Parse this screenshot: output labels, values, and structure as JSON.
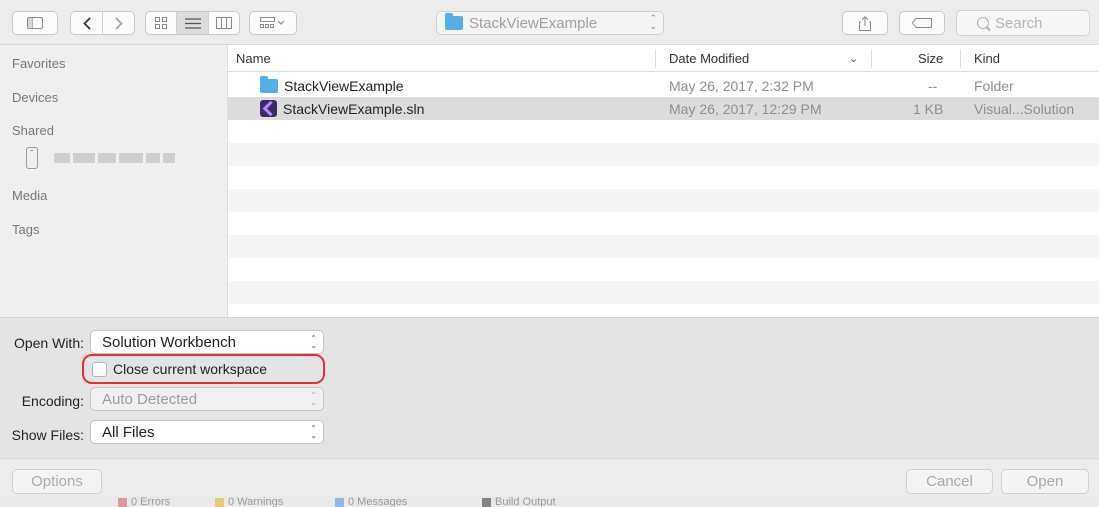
{
  "toolbar": {
    "sidebar_toggle_icon": "sidebar-icon",
    "back_icon": "chevron-left-icon",
    "forward_icon": "chevron-right-icon",
    "view_modes": [
      "icon-view",
      "list-view",
      "column-view"
    ],
    "active_view": "list-view",
    "arrange_icon": "group-icon",
    "location": "StackViewExample",
    "share_icon": "share-icon",
    "tag_icon": "tag-icon",
    "search_placeholder": "Search"
  },
  "sidebar": {
    "sections": [
      "Favorites",
      "Devices",
      "Shared",
      "Media",
      "Tags"
    ],
    "shared_device_icon": "phone-icon"
  },
  "file_list": {
    "columns": [
      "Name",
      "Date Modified",
      "Size",
      "Kind"
    ],
    "sort_column": "Date Modified",
    "rows": [
      {
        "icon": "folder-icon",
        "name": "StackViewExample",
        "date": "May 26, 2017, 2:32 PM",
        "size": "--",
        "kind": "Folder",
        "selected": false
      },
      {
        "icon": "visual-studio-solution-icon",
        "name": "StackViewExample.sln",
        "date": "May 26, 2017, 12:29 PM",
        "size": "1 KB",
        "kind": "Visual...Solution",
        "selected": true
      }
    ]
  },
  "options": {
    "open_with_label": "Open With:",
    "open_with_value": "Solution Workbench",
    "close_workspace_label": "Close current workspace",
    "close_workspace_checked": false,
    "encoding_label": "Encoding:",
    "encoding_value": "Auto Detected",
    "show_files_label": "Show Files:",
    "show_files_value": "All Files",
    "highlight_color": "#e0342c"
  },
  "buttons": {
    "options": "Options",
    "cancel": "Cancel",
    "open": "Open"
  }
}
